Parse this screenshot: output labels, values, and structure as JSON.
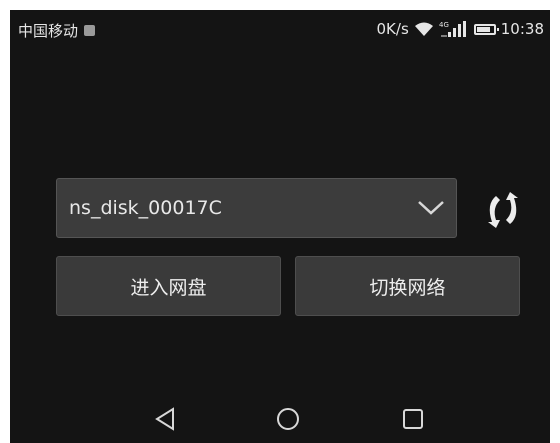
{
  "status_bar": {
    "carrier": "中国移动",
    "net_speed": "0K/s",
    "network_type": "4G",
    "time": "10:38",
    "icons": [
      "notification-icon",
      "wifi-icon",
      "signal-icon",
      "battery-icon"
    ]
  },
  "main": {
    "disk_select": {
      "value": "ns_disk_00017C"
    },
    "enter_button_label": "进入网盘",
    "switch_button_label": "切换网络"
  },
  "nav_bar": {
    "icons": [
      "back-icon",
      "home-icon",
      "recent-apps-icon"
    ]
  },
  "colors": {
    "background": "#141414",
    "control": "#3c3c3c",
    "text": "#e8e8e8"
  }
}
